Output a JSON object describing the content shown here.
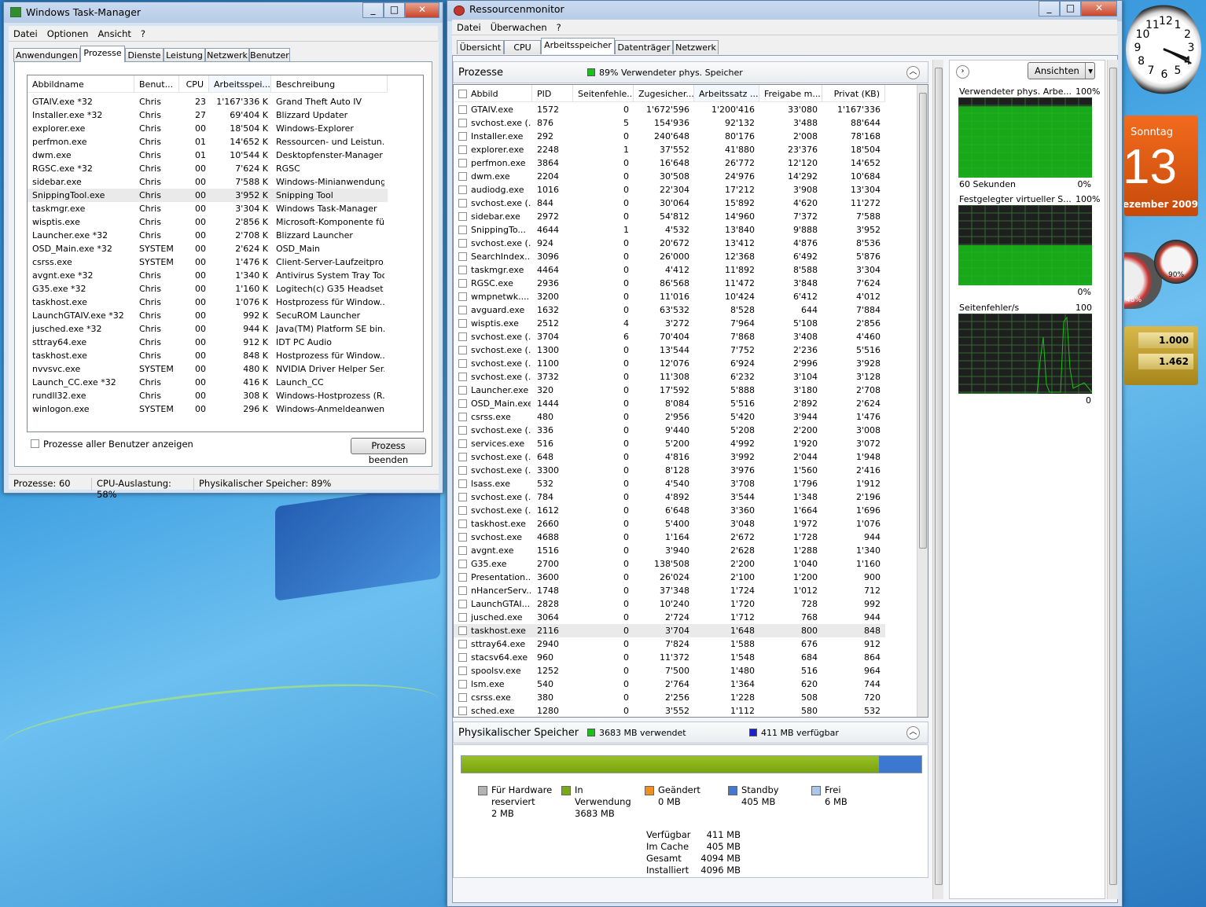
{
  "taskmgr": {
    "title": "Windows Task-Manager",
    "menu": [
      "Datei",
      "Optionen",
      "Ansicht",
      "?"
    ],
    "tabs": [
      "Anwendungen",
      "Prozesse",
      "Dienste",
      "Leistung",
      "Netzwerk",
      "Benutzer"
    ],
    "columns": [
      "Abbildname",
      "Benut...",
      "CPU",
      "Arbeitsspei...",
      "Beschreibung"
    ],
    "rows": [
      [
        "GTAIV.exe *32",
        "Chris",
        "23",
        "1'167'336 K",
        "Grand Theft Auto IV"
      ],
      [
        "Installer.exe *32",
        "Chris",
        "27",
        "69'404 K",
        "Blizzard Updater"
      ],
      [
        "explorer.exe",
        "Chris",
        "00",
        "18'504 K",
        "Windows-Explorer"
      ],
      [
        "perfmon.exe",
        "Chris",
        "01",
        "14'652 K",
        "Ressourcen- und Leistun..."
      ],
      [
        "dwm.exe",
        "Chris",
        "01",
        "10'544 K",
        "Desktopfenster-Manager"
      ],
      [
        "RGSC.exe *32",
        "Chris",
        "00",
        "7'624 K",
        "RGSC"
      ],
      [
        "sidebar.exe",
        "Chris",
        "00",
        "7'588 K",
        "Windows-Minianwendungen"
      ],
      [
        "SnippingTool.exe",
        "Chris",
        "00",
        "3'952 K",
        "Snipping Tool"
      ],
      [
        "taskmgr.exe",
        "Chris",
        "00",
        "3'304 K",
        "Windows Task-Manager"
      ],
      [
        "wisptis.exe",
        "Chris",
        "00",
        "2'856 K",
        "Microsoft-Komponente fü..."
      ],
      [
        "Launcher.exe *32",
        "Chris",
        "00",
        "2'708 K",
        "Blizzard Launcher"
      ],
      [
        "OSD_Main.exe *32",
        "SYSTEM",
        "00",
        "2'624 K",
        "OSD_Main"
      ],
      [
        "csrss.exe",
        "SYSTEM",
        "00",
        "1'476 K",
        "Client-Server-Laufzeitpro..."
      ],
      [
        "avgnt.exe *32",
        "Chris",
        "00",
        "1'340 K",
        "Antivirus System Tray Tool"
      ],
      [
        "G35.exe *32",
        "Chris",
        "00",
        "1'160 K",
        "Logitech(c) G35 Headset"
      ],
      [
        "taskhost.exe",
        "Chris",
        "00",
        "1'076 K",
        "Hostprozess für Window..."
      ],
      [
        "LaunchGTAIV.exe *32",
        "Chris",
        "00",
        "992 K",
        "SecuROM Launcher"
      ],
      [
        "jusched.exe *32",
        "Chris",
        "00",
        "944 K",
        "Java(TM) Platform SE bin..."
      ],
      [
        "sttray64.exe",
        "Chris",
        "00",
        "912 K",
        "IDT PC Audio"
      ],
      [
        "taskhost.exe",
        "Chris",
        "00",
        "848 K",
        "Hostprozess für Window..."
      ],
      [
        "nvvsvc.exe",
        "SYSTEM",
        "00",
        "480 K",
        "NVIDIA Driver Helper Ser..."
      ],
      [
        "Launch_CC.exe *32",
        "Chris",
        "00",
        "416 K",
        "Launch_CC"
      ],
      [
        "rundll32.exe",
        "Chris",
        "00",
        "308 K",
        "Windows-Hostprozess (R..."
      ],
      [
        "winlogon.exe",
        "SYSTEM",
        "00",
        "296 K",
        "Windows-Anmeldeanwen..."
      ]
    ],
    "show_all_label": "Prozesse aller Benutzer anzeigen",
    "end_process": "Prozess beenden",
    "status": [
      "Prozesse: 60",
      "CPU-Auslastung: 58%",
      "Physikalischer Speicher: 89%"
    ]
  },
  "resmon": {
    "title": "Ressourcenmonitor",
    "menu": [
      "Datei",
      "Überwachen",
      "?"
    ],
    "tabs": [
      "Übersicht",
      "CPU",
      "Arbeitsspeicher",
      "Datenträger",
      "Netzwerk"
    ],
    "proc_header": "Prozesse",
    "proc_summary": "89% Verwendeter phys. Speicher",
    "columns": [
      "Abbild",
      "PID",
      "Seitenfehle...",
      "Zugesicher...",
      "Arbeitssatz ...",
      "Freigabe m...",
      "Privat (KB)"
    ],
    "rows": [
      [
        "GTAIV.exe",
        "1572",
        "0",
        "1'672'596",
        "1'200'416",
        "33'080",
        "1'167'336"
      ],
      [
        "svchost.exe (...",
        "876",
        "5",
        "154'936",
        "92'132",
        "3'488",
        "88'644"
      ],
      [
        "Installer.exe",
        "292",
        "0",
        "240'648",
        "80'176",
        "2'008",
        "78'168"
      ],
      [
        "explorer.exe",
        "2248",
        "1",
        "37'552",
        "41'880",
        "23'376",
        "18'504"
      ],
      [
        "perfmon.exe",
        "3864",
        "0",
        "16'648",
        "26'772",
        "12'120",
        "14'652"
      ],
      [
        "dwm.exe",
        "2204",
        "0",
        "30'508",
        "24'976",
        "14'292",
        "10'684"
      ],
      [
        "audiodg.exe",
        "1016",
        "0",
        "22'304",
        "17'212",
        "3'908",
        "13'304"
      ],
      [
        "svchost.exe (...",
        "844",
        "0",
        "30'064",
        "15'892",
        "4'620",
        "11'272"
      ],
      [
        "sidebar.exe",
        "2972",
        "0",
        "54'812",
        "14'960",
        "7'372",
        "7'588"
      ],
      [
        "SnippingTo...",
        "4644",
        "1",
        "4'532",
        "13'840",
        "9'888",
        "3'952"
      ],
      [
        "svchost.exe (...",
        "924",
        "0",
        "20'672",
        "13'412",
        "4'876",
        "8'536"
      ],
      [
        "SearchIndex...",
        "3096",
        "0",
        "26'000",
        "12'368",
        "6'492",
        "5'876"
      ],
      [
        "taskmgr.exe",
        "4464",
        "0",
        "4'412",
        "11'892",
        "8'588",
        "3'304"
      ],
      [
        "RGSC.exe",
        "2936",
        "0",
        "86'568",
        "11'472",
        "3'848",
        "7'624"
      ],
      [
        "wmpnetwk....",
        "3200",
        "0",
        "11'016",
        "10'424",
        "6'412",
        "4'012"
      ],
      [
        "avguard.exe",
        "1632",
        "0",
        "63'532",
        "8'528",
        "644",
        "7'884"
      ],
      [
        "wisptis.exe",
        "2512",
        "4",
        "3'272",
        "7'964",
        "5'108",
        "2'856"
      ],
      [
        "svchost.exe (...",
        "3704",
        "6",
        "70'404",
        "7'868",
        "3'408",
        "4'460"
      ],
      [
        "svchost.exe (...",
        "1300",
        "0",
        "13'544",
        "7'752",
        "2'236",
        "5'516"
      ],
      [
        "svchost.exe (...",
        "1100",
        "0",
        "12'076",
        "6'924",
        "2'996",
        "3'928"
      ],
      [
        "svchost.exe (...",
        "3732",
        "0",
        "11'308",
        "6'232",
        "3'104",
        "3'128"
      ],
      [
        "Launcher.exe",
        "320",
        "0",
        "17'592",
        "5'888",
        "3'180",
        "2'708"
      ],
      [
        "OSD_Main.exe",
        "1444",
        "0",
        "8'084",
        "5'516",
        "2'892",
        "2'624"
      ],
      [
        "csrss.exe",
        "480",
        "0",
        "2'956",
        "5'420",
        "3'944",
        "1'476"
      ],
      [
        "svchost.exe (...",
        "336",
        "0",
        "9'440",
        "5'208",
        "2'200",
        "3'008"
      ],
      [
        "services.exe",
        "516",
        "0",
        "5'200",
        "4'992",
        "1'920",
        "3'072"
      ],
      [
        "svchost.exe (...",
        "648",
        "0",
        "4'816",
        "3'992",
        "2'044",
        "1'948"
      ],
      [
        "svchost.exe (...",
        "3300",
        "0",
        "8'128",
        "3'976",
        "1'560",
        "2'416"
      ],
      [
        "lsass.exe",
        "532",
        "0",
        "4'540",
        "3'708",
        "1'796",
        "1'912"
      ],
      [
        "svchost.exe (...",
        "784",
        "0",
        "4'892",
        "3'544",
        "1'348",
        "2'196"
      ],
      [
        "svchost.exe (...",
        "1612",
        "0",
        "6'648",
        "3'360",
        "1'664",
        "1'696"
      ],
      [
        "taskhost.exe",
        "2660",
        "0",
        "5'400",
        "3'048",
        "1'972",
        "1'076"
      ],
      [
        "svchost.exe",
        "4688",
        "0",
        "1'164",
        "2'672",
        "1'728",
        "944"
      ],
      [
        "avgnt.exe",
        "1516",
        "0",
        "3'940",
        "2'628",
        "1'288",
        "1'340"
      ],
      [
        "G35.exe",
        "2700",
        "0",
        "138'508",
        "2'200",
        "1'040",
        "1'160"
      ],
      [
        "Presentation...",
        "3600",
        "0",
        "26'024",
        "2'100",
        "1'200",
        "900"
      ],
      [
        "nHancerServ...",
        "1748",
        "0",
        "37'348",
        "1'724",
        "1'012",
        "712"
      ],
      [
        "LaunchGTAI...",
        "2828",
        "0",
        "10'240",
        "1'720",
        "728",
        "992"
      ],
      [
        "jusched.exe",
        "3064",
        "0",
        "2'724",
        "1'712",
        "768",
        "944"
      ],
      [
        "taskhost.exe",
        "2116",
        "0",
        "3'704",
        "1'648",
        "800",
        "848"
      ],
      [
        "sttray64.exe",
        "2940",
        "0",
        "7'824",
        "1'588",
        "676",
        "912"
      ],
      [
        "stacsv64.exe",
        "960",
        "0",
        "11'372",
        "1'548",
        "684",
        "864"
      ],
      [
        "spoolsv.exe",
        "1252",
        "0",
        "7'500",
        "1'480",
        "516",
        "964"
      ],
      [
        "lsm.exe",
        "540",
        "0",
        "2'764",
        "1'364",
        "620",
        "744"
      ],
      [
        "csrss.exe",
        "380",
        "0",
        "2'256",
        "1'228",
        "508",
        "720"
      ],
      [
        "sched.exe",
        "1280",
        "0",
        "3'552",
        "1'112",
        "580",
        "532"
      ]
    ],
    "phys_header": "Physikalischer Speicher",
    "phys_used": "3683 MB verwendet",
    "phys_free": "411 MB verfügbar",
    "bar_used_fraction": 0.907,
    "legend": [
      {
        "label": "Für Hardware reserviert",
        "value": "2 MB",
        "color": "#b3b3b3"
      },
      {
        "label": "In Verwendung",
        "value": "3683 MB",
        "color": "#7aa918"
      },
      {
        "label": "Geändert",
        "value": "0 MB",
        "color": "#ef8f1c"
      },
      {
        "label": "Standby",
        "value": "405 MB",
        "color": "#4479d0"
      },
      {
        "label": "Frei",
        "value": "6 MB",
        "color": "#aac8ee"
      }
    ],
    "totals": [
      [
        "Verfügbar",
        "411 MB"
      ],
      [
        "Im Cache",
        "405 MB"
      ],
      [
        "Gesamt",
        "4094 MB"
      ],
      [
        "Installiert",
        "4096 MB"
      ]
    ],
    "views_btn": "Ansichten",
    "graphs": [
      {
        "title": "Verwendeter phys. Arbe...",
        "max": "100%",
        "left": "60 Sekunden",
        "right": "0%",
        "level": 0.89
      },
      {
        "title": "Festgelegter virtueller S...",
        "max": "100%",
        "left": "",
        "right": "0%",
        "level": 0.5
      },
      {
        "title": "Seitenfehler/s",
        "max": "100",
        "left": "",
        "right": "0",
        "level": 0.0
      }
    ]
  },
  "desktop": {
    "clock_numbers": [
      "12",
      "1",
      "2",
      "3",
      "4",
      "5",
      "6",
      "7",
      "8",
      "9",
      "10",
      "11"
    ],
    "cal_day": "Sonntag",
    "cal_date": "13",
    "cal_month": "ezember 2009",
    "cpu_gauge": "48%",
    "mem_gauge": "90%",
    "cur1": "1.000",
    "cur2": "1.462"
  },
  "colors": {
    "graph_green": "#19c119",
    "accent_used": "#86ad16",
    "accent_free": "#3d78d0"
  }
}
